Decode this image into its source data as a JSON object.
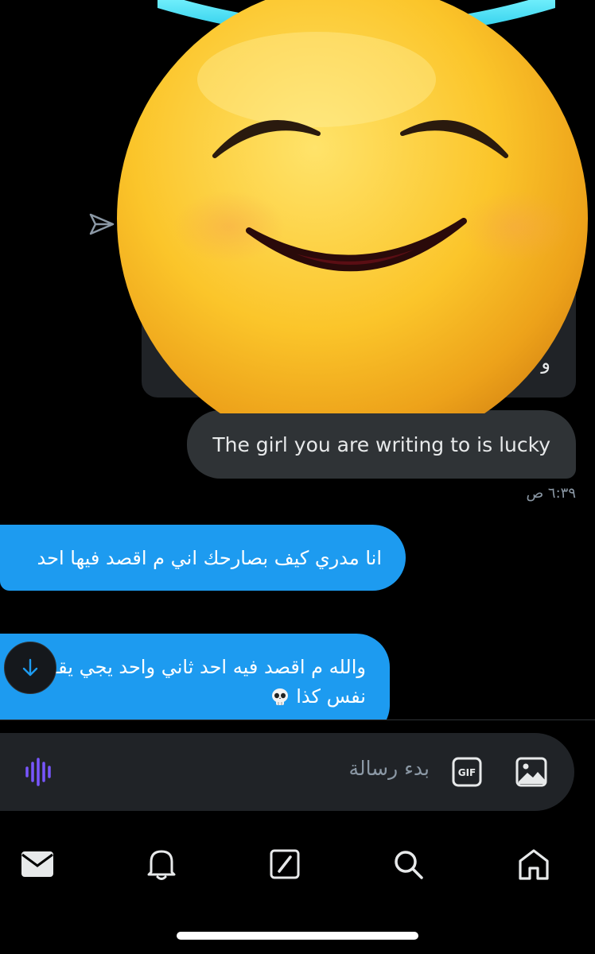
{
  "conversation": {
    "quoted_card": {
      "text": "نص\nو الجمهو"
    },
    "sent_message": {
      "text": "The girl you are writing to is lucky",
      "time": "٦:٣٩ ص"
    },
    "received_messages": [
      {
        "text": "انا مدري كيف بصارحك اني م اقصد فيها احد"
      },
      {
        "text": "والله م اقصد فيه احد ثاني واحد يجي يقول نفس كذا"
      }
    ]
  },
  "composer": {
    "placeholder": "بدء رسالة",
    "gif_label": "GIF"
  },
  "nav": {
    "items": [
      "messages",
      "notifications",
      "compose",
      "search",
      "home"
    ]
  },
  "overlay": {
    "emoji": "smiling-face-with-halo-emoji"
  },
  "colors": {
    "accent": "#1d9bf0",
    "bubble_dark": "#2f3336",
    "mic_purple": "#7856ff"
  }
}
